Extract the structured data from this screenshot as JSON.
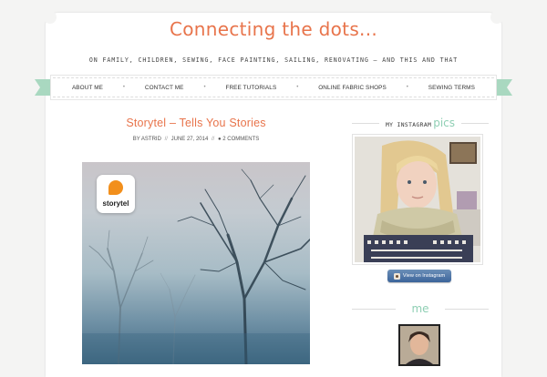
{
  "site": {
    "title": "Connecting the dots...",
    "tagline": "ON FAMILY, CHILDREN, SEWING, FACE PAINTING, SAILING, RENOVATING – AND THIS AND THAT"
  },
  "nav": {
    "items": [
      {
        "label": "ABOUT ME"
      },
      {
        "label": "CONTACT ME"
      },
      {
        "label": "FREE TUTORIALS"
      },
      {
        "label": "ONLINE FABRIC SHOPS"
      },
      {
        "label": "SEWING TERMS"
      }
    ],
    "separator": "•"
  },
  "post": {
    "title": "Storytel – Tells You Stories",
    "meta": {
      "by": "BY ASTRID",
      "sep1": "//",
      "date": "JUNE 27, 2014",
      "sep2": "//",
      "comments": "2 COMMENTS"
    },
    "featured_logo_text": "storytel"
  },
  "sidebar": {
    "instagram": {
      "title_a": "MY INSTAGRAM",
      "title_b": "pics",
      "button_label": "View on Instagram"
    },
    "me": {
      "title": "me"
    }
  },
  "colors": {
    "accent": "#e8744b",
    "mint": "#8fcfb4",
    "ribbon": "#a9d8c0"
  }
}
